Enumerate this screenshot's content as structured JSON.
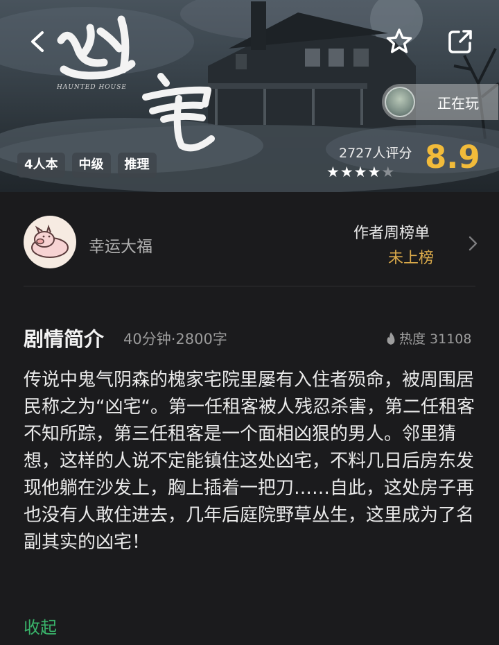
{
  "hero": {
    "game_title": "凶宅",
    "game_subtitle": "HAUNTED HOUSE",
    "playing_label": "正在玩",
    "tags": [
      "4人本",
      "中级",
      "推理"
    ],
    "rating": {
      "count_label": "2727人评分",
      "stars_filled": 4,
      "stars_total": 5,
      "score": "8.9"
    },
    "icons": {
      "back": "chevron-left-icon",
      "favorite": "star-outline-icon",
      "share": "share-icon"
    }
  },
  "author": {
    "name": "幸运大福",
    "rank_title": "作者周榜单",
    "rank_status": "未上榜"
  },
  "synopsis": {
    "title": "剧情简介",
    "meta": "40分钟·2800字",
    "heat": "热度 31108",
    "body": "传说中鬼气阴森的槐家宅院里屡有入住者殒命，被周围居民称之为“凶宅“。第一任租客被人残忍杀害，第二任租客不知所踪，第三任租客是一个面相凶狠的男人。邻里猜想，这样的人说不定能镇住这处凶宅，不料几日后房东发现他躺在沙发上，胸上插着一把刀……自此，这处房子再也没有人敢住进去，几年后庭院野草丛生，这里成为了名副其实的凶宅！",
    "collapse_label": "收起"
  },
  "colors": {
    "background": "#1b1b1d",
    "score": "#f2bb3a",
    "rank_status": "#d9a94a",
    "collapse": "#39b36a"
  }
}
